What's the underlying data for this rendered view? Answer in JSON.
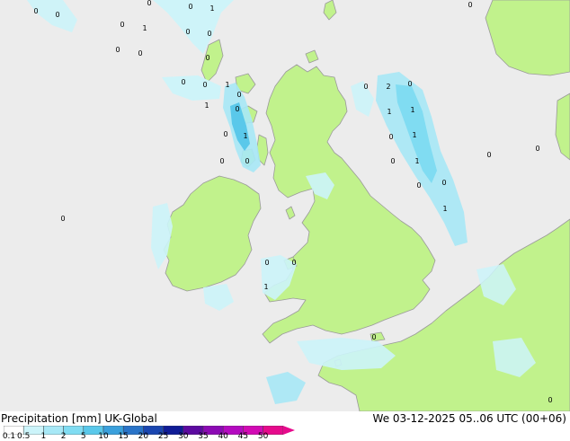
{
  "footer": {
    "title": "Precipitation [mm]  UK-Global",
    "timestamp": "We 03-12-2025 05..06 UTC (00+06)"
  },
  "legend": {
    "ticks": [
      "0.1",
      "0.5",
      "1",
      "2",
      "5",
      "10",
      "15",
      "20",
      "25",
      "30",
      "35",
      "40",
      "45",
      "50"
    ],
    "colors": [
      "#ffffff",
      "#ccf4fa",
      "#a7e8f6",
      "#80dcf2",
      "#5ac8ea",
      "#3aa0dc",
      "#2a74c8",
      "#1a46b0",
      "#101c96",
      "#5c0aa0",
      "#8c0ab4",
      "#b40ac0",
      "#d20ab4",
      "#e60a8c"
    ]
  },
  "map": {
    "land_color": "#c1f28c",
    "sea_color": "#ececec",
    "coast_color": "#9a9a9a",
    "point_labels": [
      {
        "id": "p1",
        "text": "0"
      },
      {
        "id": "p2",
        "text": "0"
      },
      {
        "id": "p3",
        "text": "0"
      },
      {
        "id": "p4",
        "text": "0"
      },
      {
        "id": "p5",
        "text": "1"
      },
      {
        "id": "p6",
        "text": "0"
      },
      {
        "id": "p7",
        "text": "1"
      },
      {
        "id": "p8",
        "text": "0"
      },
      {
        "id": "p9",
        "text": "0"
      },
      {
        "id": "p10",
        "text": "0"
      },
      {
        "id": "p11",
        "text": "0"
      },
      {
        "id": "p12",
        "text": "0"
      },
      {
        "id": "p13",
        "text": "0"
      },
      {
        "id": "p14",
        "text": "1"
      },
      {
        "id": "p15",
        "text": "0"
      },
      {
        "id": "p16",
        "text": "0"
      },
      {
        "id": "p17",
        "text": "1"
      },
      {
        "id": "p18",
        "text": "0"
      },
      {
        "id": "p19",
        "text": "0"
      },
      {
        "id": "p20",
        "text": "0"
      },
      {
        "id": "p21",
        "text": "2"
      },
      {
        "id": "p22",
        "text": "0"
      },
      {
        "id": "p23",
        "text": "1"
      },
      {
        "id": "p24",
        "text": "1"
      },
      {
        "id": "p25",
        "text": "0"
      },
      {
        "id": "p26",
        "text": "1"
      },
      {
        "id": "p27",
        "text": "0"
      },
      {
        "id": "p28",
        "text": "1"
      },
      {
        "id": "p29",
        "text": "0"
      },
      {
        "id": "p30",
        "text": "0"
      },
      {
        "id": "p31",
        "text": "1"
      },
      {
        "id": "p32",
        "text": "0"
      },
      {
        "id": "p33",
        "text": "0"
      },
      {
        "id": "p34",
        "text": "0"
      },
      {
        "id": "p35",
        "text": "0"
      },
      {
        "id": "p36",
        "text": "0"
      },
      {
        "id": "p37",
        "text": "0"
      },
      {
        "id": "p38",
        "text": "1"
      },
      {
        "id": "p39",
        "text": "1"
      },
      {
        "id": "p40",
        "text": "0"
      },
      {
        "id": "p41",
        "text": "0"
      },
      {
        "id": "p42",
        "text": "0"
      },
      {
        "id": "p43",
        "text": "0"
      }
    ]
  }
}
